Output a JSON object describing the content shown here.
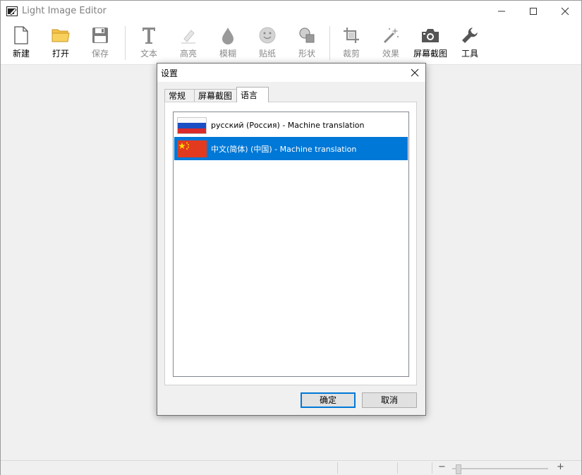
{
  "app": {
    "title": "Light Image Editor"
  },
  "toolbar": {
    "new": "新建",
    "open": "打开",
    "save": "保存",
    "text": "文本",
    "highlight": "高亮",
    "blur": "模糊",
    "sticker": "贴纸",
    "shape": "形状",
    "crop": "裁剪",
    "effects": "效果",
    "screenshot": "屏幕截图",
    "tools": "工具"
  },
  "dialog": {
    "title": "设置",
    "tabs": [
      "常规",
      "屏幕截图",
      "语言"
    ],
    "languages": [
      {
        "label": "русский (Россия) - Machine translation",
        "flag": "russia"
      },
      {
        "label": "中文(简体) (中国) - Machine translation",
        "flag": "china",
        "selected": true
      }
    ],
    "ok": "确定",
    "cancel": "取消"
  },
  "status": {
    "zoom_minus": "−",
    "zoom_plus": "+",
    "zoom_level": 0.04
  },
  "colors": {
    "accent": "#0078d7",
    "folder": "#f5c242"
  }
}
